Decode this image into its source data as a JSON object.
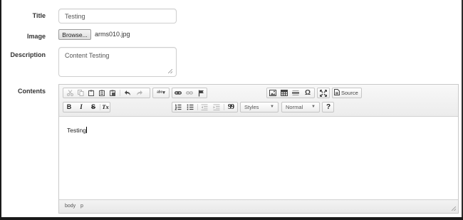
{
  "form": {
    "title_label": "Title",
    "title_value": "Testing",
    "image_label": "Image",
    "browse_label": "Browse...",
    "file_name": "arms010.jpg",
    "description_label": "Description",
    "description_value": "Content Testing",
    "contents_label": "Contents"
  },
  "editor": {
    "toolbar": {
      "source_label": "Source",
      "bold": "B",
      "italic": "I",
      "strike": "S",
      "remove_format": "Tx",
      "blockquote": "99",
      "special_char": "Ω",
      "help": "?",
      "styles_combo": "Styles",
      "format_combo": "Normal"
    },
    "content_text": "Testing",
    "path": [
      "body",
      "p"
    ]
  },
  "icons": [
    "cut-icon",
    "copy-icon",
    "paste-icon",
    "paste-text-icon",
    "paste-word-icon",
    "undo-icon",
    "redo-icon",
    "spellcheck-icon",
    "link-icon",
    "unlink-icon",
    "anchor-icon",
    "image-icon",
    "table-icon",
    "horizontal-rule-icon",
    "special-char-icon",
    "maximize-icon",
    "source-icon",
    "numbered-list-icon",
    "bulleted-list-icon",
    "outdent-icon",
    "indent-icon",
    "blockquote-icon",
    "help-icon"
  ]
}
